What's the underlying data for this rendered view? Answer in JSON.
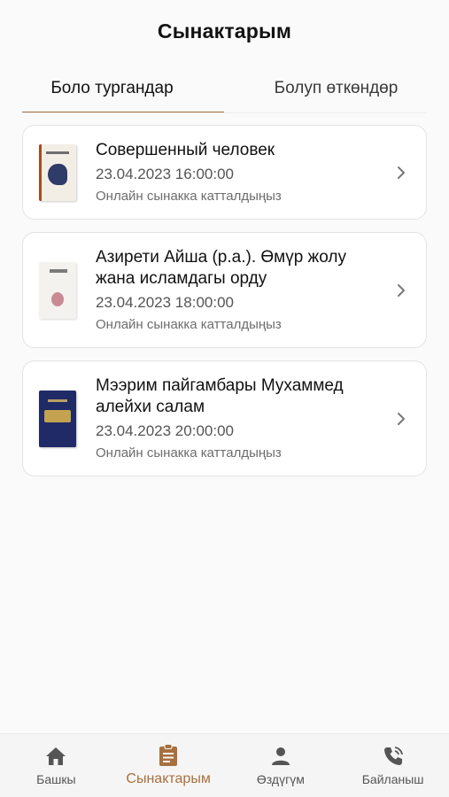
{
  "header": {
    "title": "Сынактарым"
  },
  "tabs": [
    {
      "label": "Боло тургандар",
      "active": true
    },
    {
      "label": "Болуп өткөндөр",
      "active": false
    }
  ],
  "tests": [
    {
      "title": "Совершенный человек",
      "date": "23.04.2023 16:00:00",
      "status": "Онлайн сынакка катталдыңыз"
    },
    {
      "title": "Азирети Айша (р.а.). Өмүр жолу жана исламдагы орду",
      "date": "23.04.2023 18:00:00",
      "status": "Онлайн сынакка катталдыңыз"
    },
    {
      "title": "Мээрим пайгамбары Мухаммед алейхи салам",
      "date": "23.04.2023 20:00:00",
      "status": "Онлайн сынакка катталдыңыз"
    }
  ],
  "bottom_nav": [
    {
      "label": "Башкы",
      "icon": "home-icon",
      "active": false
    },
    {
      "label": "Сынактарым",
      "icon": "clipboard-icon",
      "active": true
    },
    {
      "label": "Өздүгүм",
      "icon": "person-icon",
      "active": false
    },
    {
      "label": "Байланыш",
      "icon": "phone-icon",
      "active": false
    }
  ],
  "colors": {
    "accent": "#a8703d",
    "background": "#fafafa",
    "card_border": "#e3e3e3"
  }
}
